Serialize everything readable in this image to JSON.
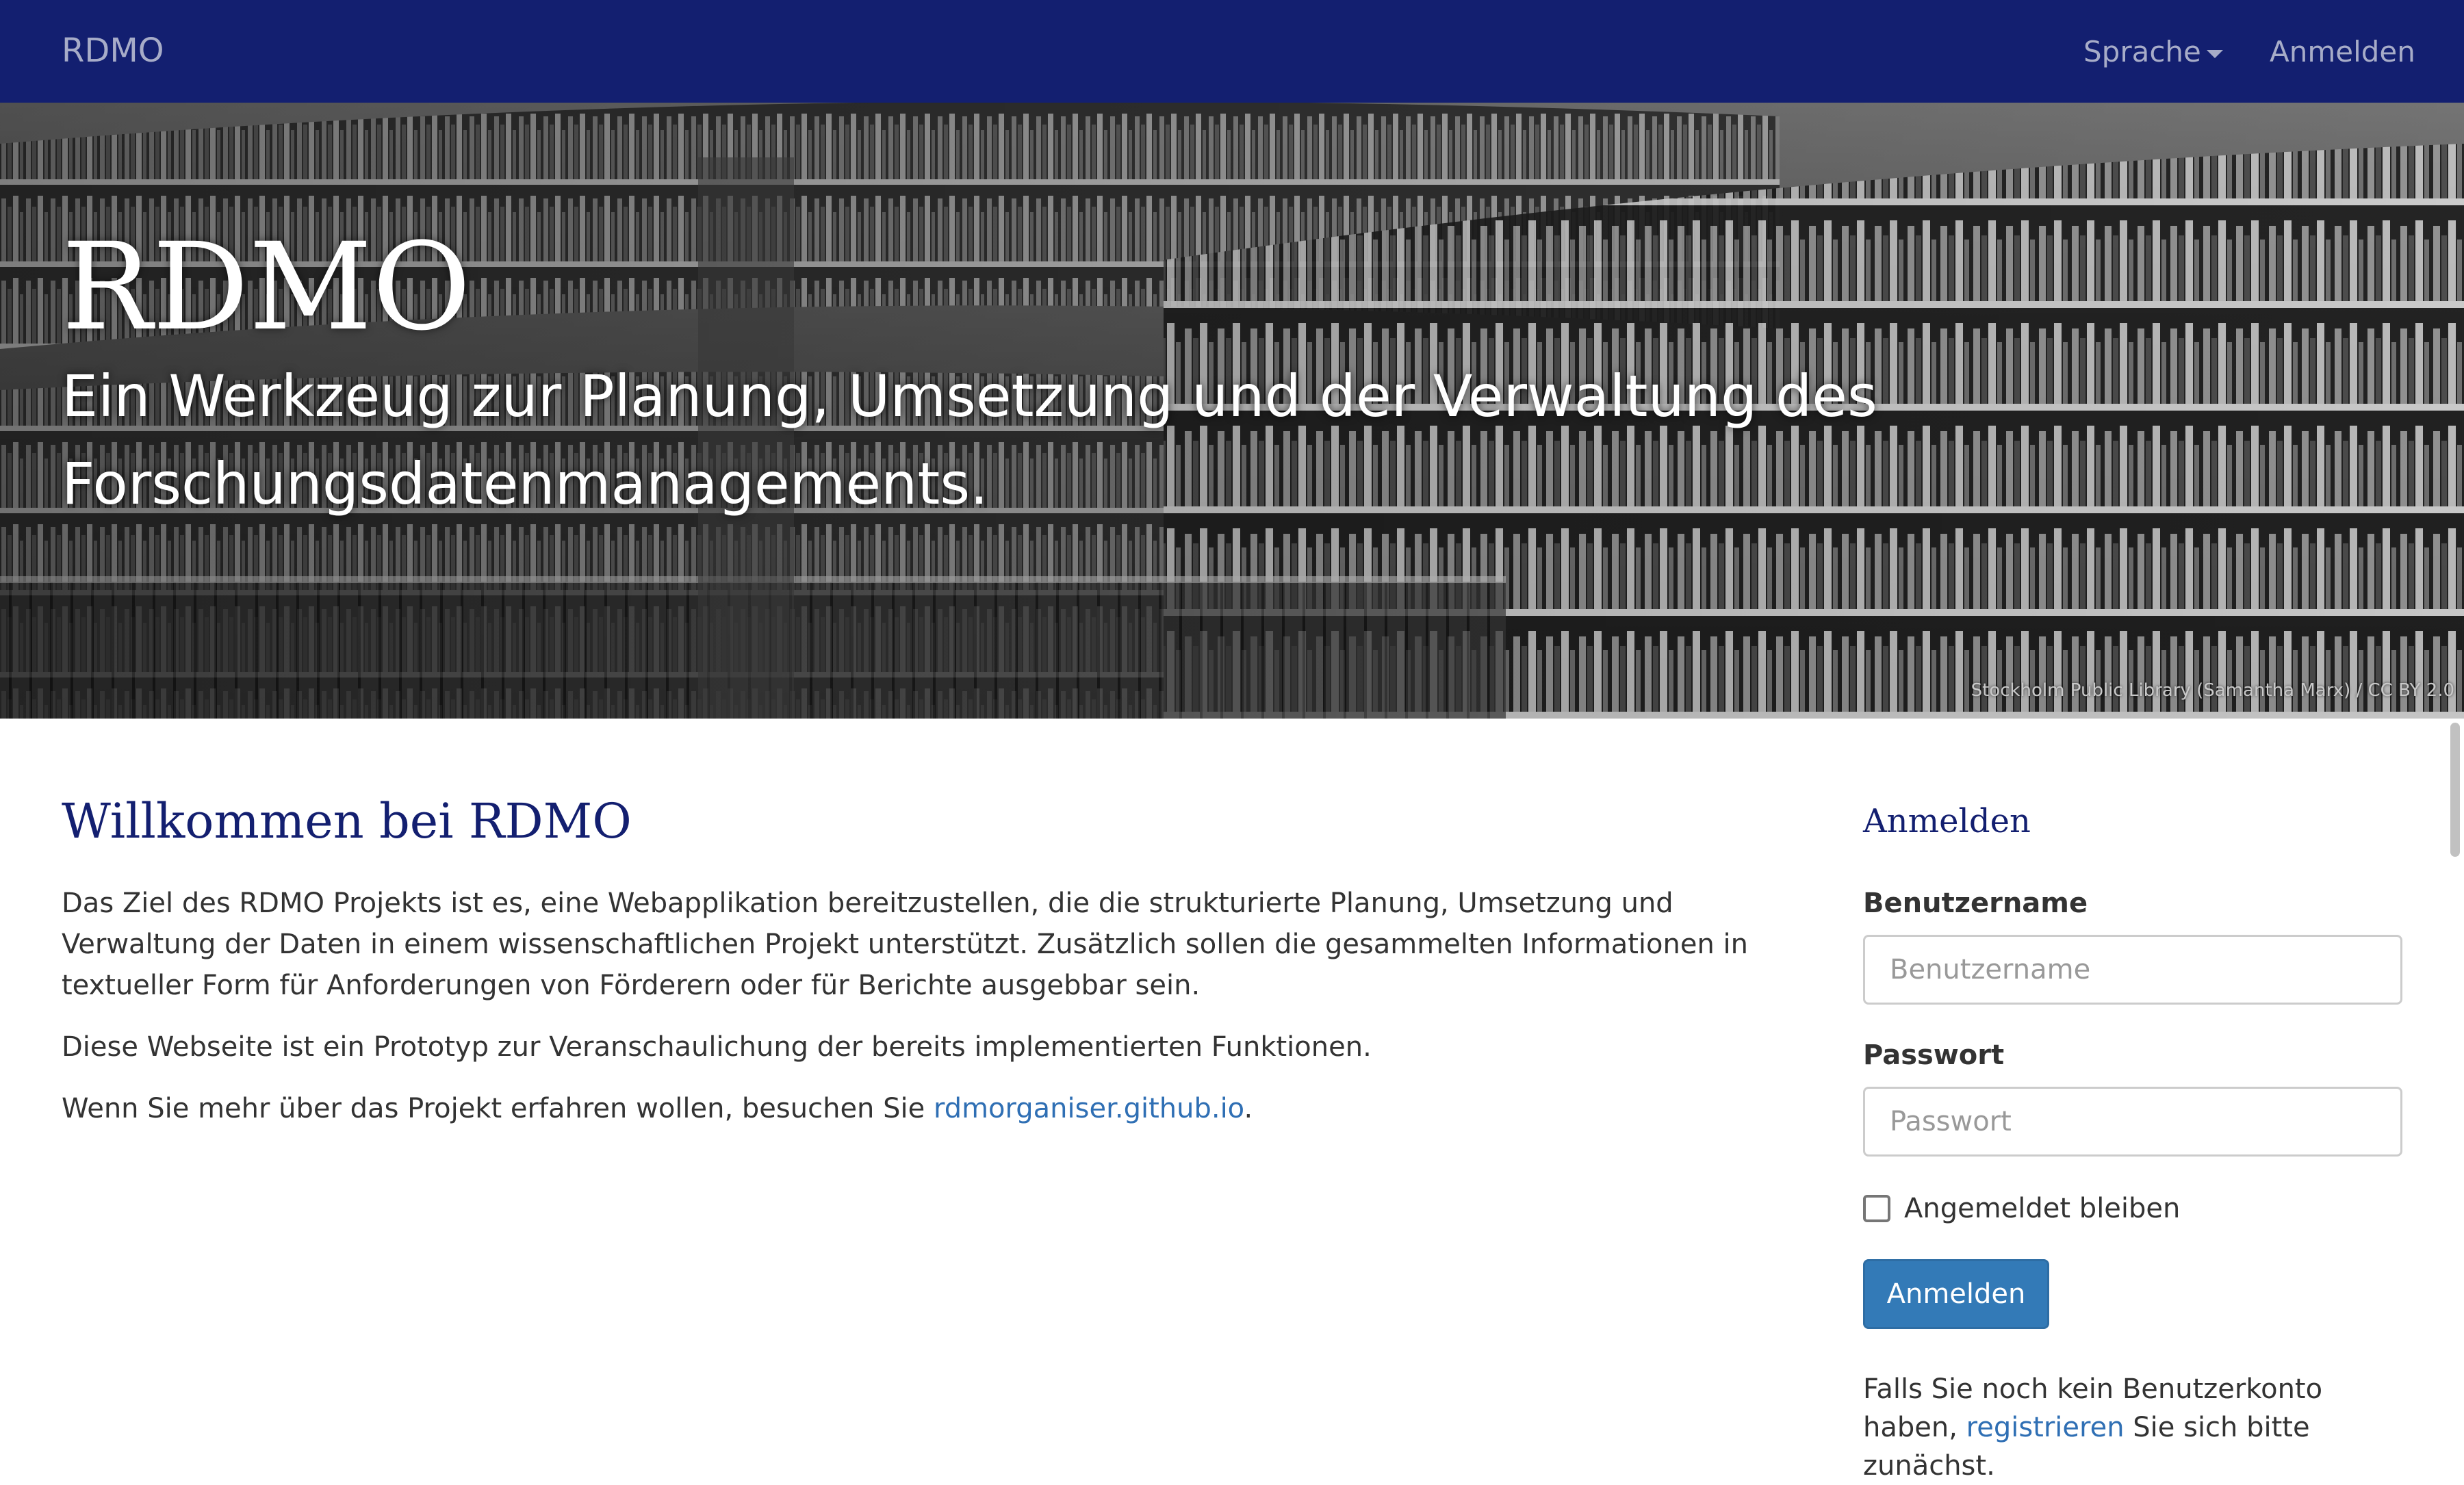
{
  "navbar": {
    "brand": "RDMO",
    "language_label": "Sprache",
    "login_label": "Anmelden"
  },
  "hero": {
    "title": "RDMO",
    "subtitle": "Ein Werkzeug zur Planung, Umsetzung und der Verwaltung des Forschungsdatenmanagements.",
    "image_credit": "Stockholm Public Library (Samantha Marx) / CC BY 2.0"
  },
  "main": {
    "title": "Willkommen bei RDMO",
    "paragraph_1": "Das Ziel des RDMO Projekts ist es, eine Webapplikation bereitzustellen, die die strukturierte Planung, Umsetzung und Verwaltung der Daten in einem wissenschaftlichen Projekt unterstützt. Zusätzlich sollen die gesammelten Informationen in textueller Form für Anforderungen von Förderern oder für Berichte ausgebbar sein.",
    "paragraph_2": "Diese Webseite ist ein Prototyp zur Veranschaulichung der bereits implementierten Funktionen.",
    "paragraph_3_prefix": "Wenn Sie mehr über das Projekt erfahren wollen, besuchen Sie ",
    "paragraph_3_link": "rdmorganiser.github.io",
    "paragraph_3_suffix": "."
  },
  "login": {
    "heading": "Anmelden",
    "username_label": "Benutzername",
    "username_placeholder": "Benutzername",
    "username_value": "",
    "password_label": "Passwort",
    "password_placeholder": "Passwort",
    "password_value": "",
    "remember_label": "Angemeldet bleiben",
    "remember_checked": false,
    "submit_label": "Anmelden",
    "signup_prefix": "Falls Sie noch kein Benutzerkonto haben, ",
    "signup_link": "registrieren",
    "signup_suffix": " Sie sich bitte zunächst."
  },
  "colors": {
    "navbar_bg": "#131f70",
    "heading": "#131f70",
    "link": "#2f6fb4",
    "primary_button": "#337ab7"
  }
}
